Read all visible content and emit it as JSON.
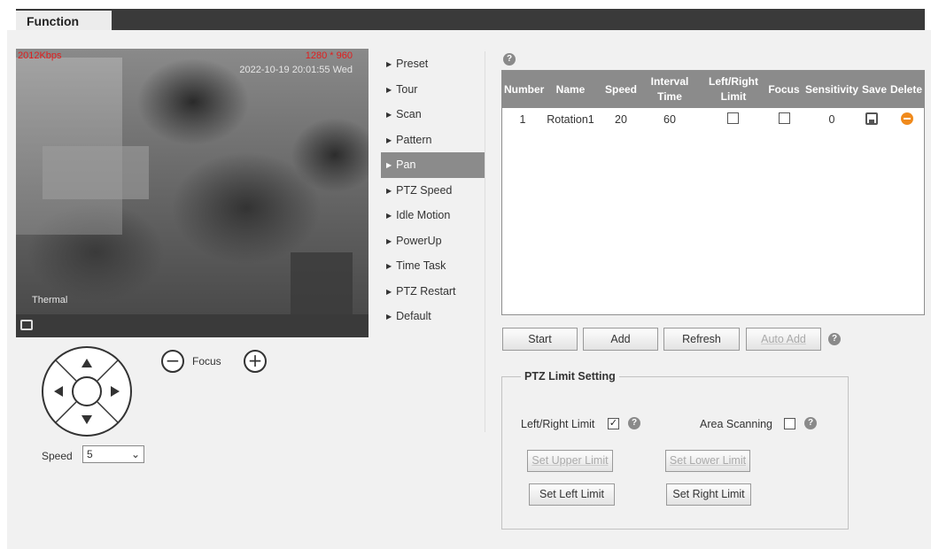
{
  "header": {
    "tab_label": "Function"
  },
  "video": {
    "bitrate": "2012Kbps",
    "resolution": "1280 * 960",
    "timestamp": "2022-10-19 20:01:55 Wed",
    "channel_label": "Thermal"
  },
  "ptz_control": {
    "focus_label": "Focus",
    "speed_label": "Speed",
    "speed_value": "5"
  },
  "menu": {
    "items": [
      "Preset",
      "Tour",
      "Scan",
      "Pattern",
      "Pan",
      "PTZ Speed",
      "Idle Motion",
      "PowerUp",
      "Time Task",
      "PTZ Restart",
      "Default"
    ],
    "active": "Pan"
  },
  "table": {
    "headers": {
      "number": "Number",
      "name": "Name",
      "speed": "Speed",
      "interval_1": "Interval",
      "interval_2": "Time",
      "limit_1": "Left/Right",
      "limit_2": "Limit",
      "focus": "Focus",
      "sensitivity": "Sensitivity",
      "save": "Save",
      "delete": "Delete"
    },
    "rows": [
      {
        "number": "1",
        "name": "Rotation1",
        "speed": "20",
        "interval": "60",
        "limit_checked": false,
        "focus_checked": false,
        "sensitivity": "0"
      }
    ]
  },
  "actions": {
    "start": "Start",
    "add": "Add",
    "refresh": "Refresh",
    "auto_add": "Auto Add"
  },
  "limit_setting": {
    "title": "PTZ Limit Setting",
    "left_right_label": "Left/Right Limit",
    "left_right_checked": true,
    "left_right_mark": "✓",
    "area_scanning_label": "Area Scanning",
    "area_scanning_checked": false,
    "set_upper": "Set Upper Limit",
    "set_lower": "Set Lower Limit",
    "set_left": "Set Left Limit",
    "set_right": "Set Right Limit"
  },
  "colors": {
    "header_bar": "#3a3a3a",
    "menu_active": "#8b8b8b",
    "delete_icon": "#f08a1c",
    "video_overlay_red": "#e21d1d"
  }
}
